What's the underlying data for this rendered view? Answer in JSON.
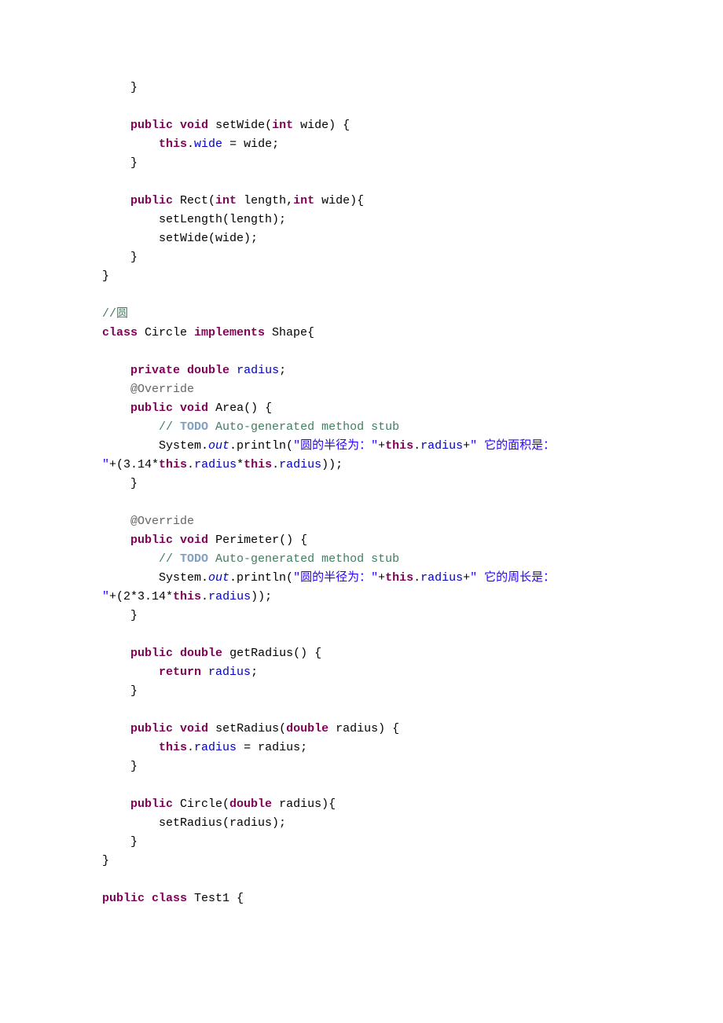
{
  "t": {
    "l00": "    }",
    "l01": "",
    "l02a": "    ",
    "l02b": "public",
    "l02c": " ",
    "l02d": "void",
    "l02e": " setWide(",
    "l02f": "int",
    "l02g": " wide) {",
    "l03a": "        ",
    "l03b": "this",
    "l03c": ".",
    "l03d": "wide",
    "l03e": " = wide;",
    "l04": "    }",
    "l05": "",
    "l06a": "    ",
    "l06b": "public",
    "l06c": " Rect(",
    "l06d": "int",
    "l06e": " length,",
    "l06f": "int",
    "l06g": " wide){",
    "l07": "        setLength(length);",
    "l08": "        setWide(wide);",
    "l09": "    }",
    "l10": "}",
    "l11": "",
    "l12a": "//",
    "l12b": "圆",
    "l13a": "class",
    "l13b": " Circle ",
    "l13c": "implements",
    "l13d": " Shape{",
    "l14": "",
    "l15a": "    ",
    "l15b": "private",
    "l15c": " ",
    "l15d": "double",
    "l15e": " ",
    "l15f": "radius",
    "l15g": ";",
    "l16a": "    ",
    "l16b": "@Override",
    "l17a": "    ",
    "l17b": "public",
    "l17c": " ",
    "l17d": "void",
    "l17e": " Area() {",
    "l18a": "        ",
    "l18b": "// ",
    "l18c": "TODO",
    "l18d": " Auto-generated method stub",
    "l19a": "        System.",
    "l19b": "out",
    "l19c": ".println(",
    "l19d": "\"圆的半径为：\"",
    "l19e": "+",
    "l19f": "this",
    "l19g": ".",
    "l19h": "radius",
    "l19i": "+",
    "l19j": "\" 它的面积是：",
    "l20a": "\"",
    "l20b": "+(3.14*",
    "l20c": "this",
    "l20d": ".",
    "l20e": "radius",
    "l20f": "*",
    "l20g": "this",
    "l20h": ".",
    "l20i": "radius",
    "l20j": "));",
    "l21": "    }",
    "l22": "",
    "l23a": "    ",
    "l23b": "@Override",
    "l24a": "    ",
    "l24b": "public",
    "l24c": " ",
    "l24d": "void",
    "l24e": " Perimeter() {",
    "l25a": "        ",
    "l25b": "// ",
    "l25c": "TODO",
    "l25d": " Auto-generated method stub",
    "l26a": "        System.",
    "l26b": "out",
    "l26c": ".println(",
    "l26d": "\"圆的半径为：\"",
    "l26e": "+",
    "l26f": "this",
    "l26g": ".",
    "l26h": "radius",
    "l26i": "+",
    "l26j": "\" 它的周长是：",
    "l27a": "\"",
    "l27b": "+(2*3.14*",
    "l27c": "this",
    "l27d": ".",
    "l27e": "radius",
    "l27f": "));",
    "l28": "    }",
    "l29": "",
    "l30a": "    ",
    "l30b": "public",
    "l30c": " ",
    "l30d": "double",
    "l30e": " getRadius() {",
    "l31a": "        ",
    "l31b": "return",
    "l31c": " ",
    "l31d": "radius",
    "l31e": ";",
    "l32": "    }",
    "l33": "",
    "l34a": "    ",
    "l34b": "public",
    "l34c": " ",
    "l34d": "void",
    "l34e": " setRadius(",
    "l34f": "double",
    "l34g": " radius) {",
    "l35a": "        ",
    "l35b": "this",
    "l35c": ".",
    "l35d": "radius",
    "l35e": " = radius;",
    "l36": "    }",
    "l37": "",
    "l38a": "    ",
    "l38b": "public",
    "l38c": " Circle(",
    "l38d": "double",
    "l38e": " radius){",
    "l39": "        setRadius(radius);",
    "l40": "    }",
    "l41": "}",
    "l42": "",
    "l43a": "public",
    "l43b": " ",
    "l43c": "class",
    "l43d": " Test1 {"
  }
}
